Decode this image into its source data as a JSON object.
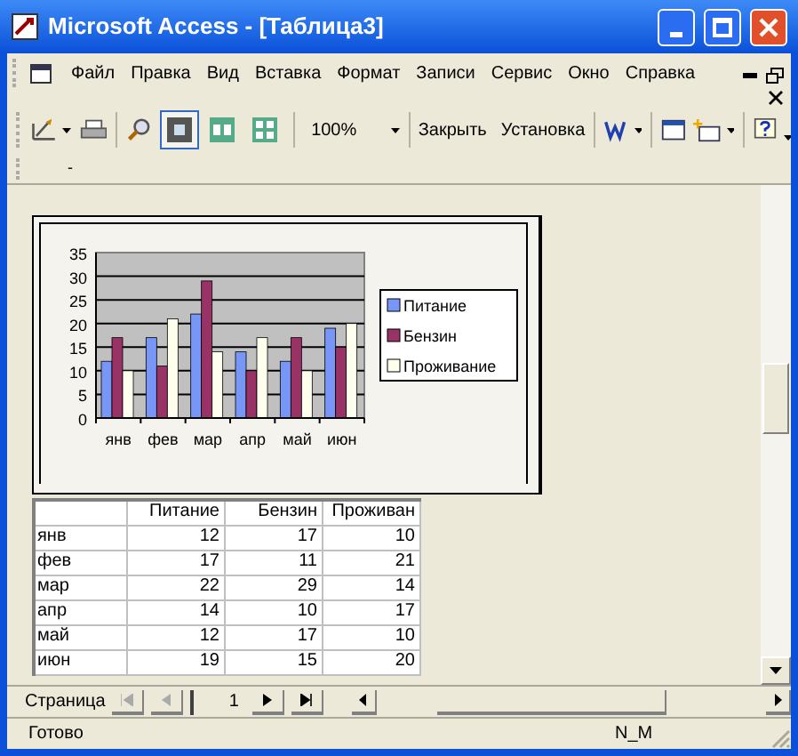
{
  "window": {
    "title": "Microsoft Access - [Таблица3]"
  },
  "menu": [
    "Файл",
    "Правка",
    "Вид",
    "Вставка",
    "Формат",
    "Записи",
    "Сервис",
    "Окно",
    "Справка"
  ],
  "toolbar": {
    "zoom": "100%",
    "buttons": [
      "Закрыть",
      "Установка"
    ],
    "view_modes": [
      {
        "selected": true
      },
      {
        "selected": false
      },
      {
        "selected": false
      }
    ]
  },
  "toolbar_2": {
    "label": "-"
  },
  "report": {
    "chart": {
      "chart_data": {
        "type": "bar",
        "categories": [
          "янв",
          "фев",
          "мар",
          "апр",
          "май",
          "июн"
        ],
        "series": [
          {
            "name": "Питание",
            "color": "#7796f6",
            "values": [
              12,
              17,
              22,
              14,
              12,
              19
            ]
          },
          {
            "name": "Бензин",
            "color": "#993366",
            "values": [
              17,
              11,
              29,
              10,
              17,
              15
            ]
          },
          {
            "name": "Проживание",
            "color": "#ffffee",
            "values": [
              10,
              21,
              14,
              17,
              10,
              20
            ]
          }
        ],
        "grid": true,
        "legend": true,
        "ylim": [
          0,
          35
        ],
        "yticks": [
          0,
          5,
          10,
          15,
          20,
          25,
          30,
          35
        ]
      }
    },
    "table": {
      "columns": [
        "Питание",
        "Бензин",
        "Проживан"
      ],
      "rows": [
        {
          "label": "янв",
          "cells": [
            "12",
            "17",
            "10"
          ]
        },
        {
          "label": "фев",
          "cells": [
            "17",
            "11",
            "21"
          ]
        },
        {
          "label": "мар",
          "cells": [
            "22",
            "29",
            "14"
          ]
        },
        {
          "label": "апр",
          "cells": [
            "14",
            "10",
            "17"
          ]
        },
        {
          "label": "май",
          "cells": [
            "12",
            "17",
            "10"
          ]
        },
        {
          "label": "июн",
          "cells": [
            "19",
            "15",
            "20"
          ]
        }
      ]
    }
  },
  "navigation": {
    "label": "Страница",
    "page": "1"
  },
  "status_bar": {
    "text": "Готово",
    "indicator": "N_M"
  }
}
